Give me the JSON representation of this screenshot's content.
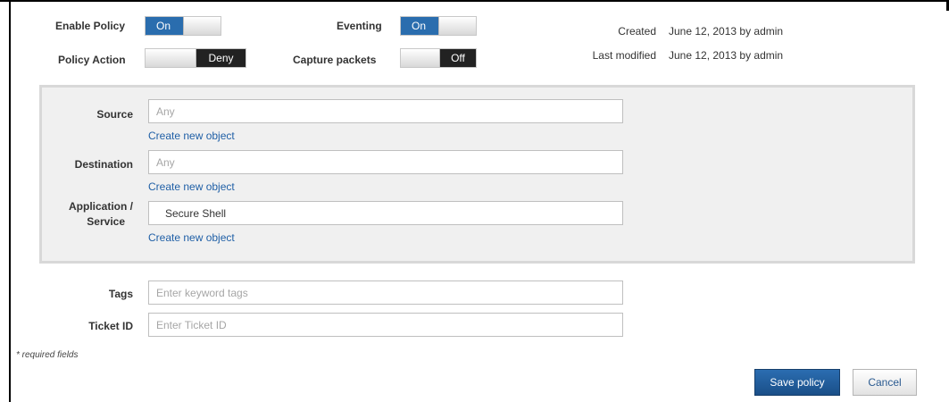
{
  "header": {
    "enable_policy": {
      "label": "Enable Policy",
      "value": "On"
    },
    "eventing": {
      "label": "Eventing",
      "value": "On"
    },
    "policy_action": {
      "label": "Policy Action",
      "value": "Deny"
    },
    "capture_packets": {
      "label": "Capture packets",
      "value": "Off"
    },
    "created": {
      "label": "Created",
      "value": "June 12, 2013 by admin"
    },
    "last_modified": {
      "label": "Last modified",
      "value": "June 12, 2013 by admin"
    }
  },
  "panel": {
    "source": {
      "label": "Source",
      "placeholder": "Any",
      "value": "",
      "link": "Create new object"
    },
    "destination": {
      "label": "Destination",
      "placeholder": "Any",
      "value": "",
      "link": "Create new object"
    },
    "application": {
      "label_line1": "Application /",
      "label_line2": "Service",
      "value": "Secure Shell",
      "link": "Create new object"
    }
  },
  "tags": {
    "label": "Tags",
    "placeholder": "Enter keyword tags"
  },
  "ticket": {
    "label": "Ticket ID",
    "placeholder": "Enter Ticket ID"
  },
  "required_note": "* required fields",
  "buttons": {
    "save": "Save policy",
    "cancel": "Cancel"
  },
  "colors": {
    "accent": "#2a6dae",
    "link": "#1f5fa6",
    "dark_toggle": "#222222",
    "panel_bg": "#f0f0f0"
  }
}
